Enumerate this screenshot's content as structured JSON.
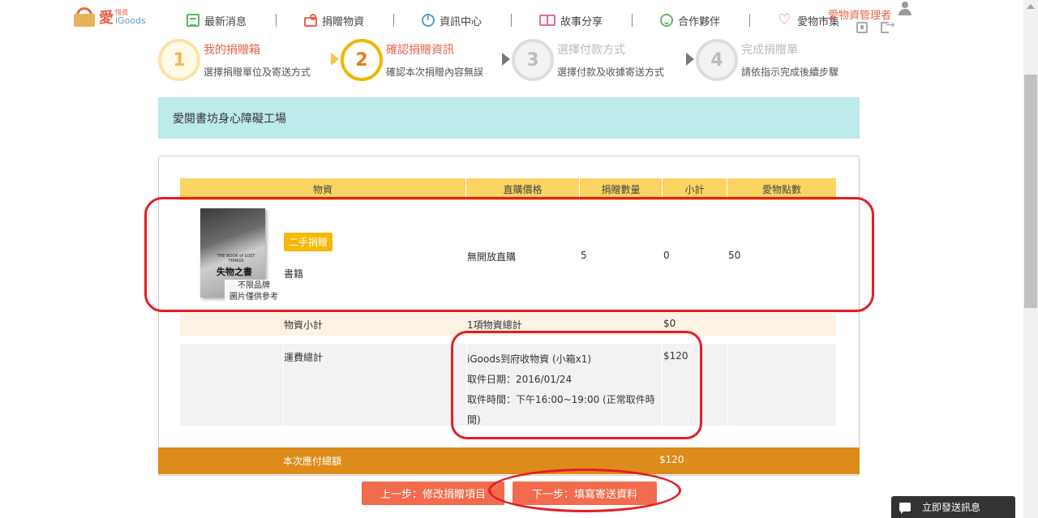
{
  "brand": {
    "name_zh": "愛",
    "name_small": "惜資",
    "name_en": "iGoods"
  },
  "nav": [
    {
      "label": "最新消息"
    },
    {
      "label": "捐贈物資"
    },
    {
      "label": "資訊中心"
    },
    {
      "label": "故事分享"
    },
    {
      "label": "合作夥伴"
    },
    {
      "label": "愛物市集"
    }
  ],
  "user": {
    "name": "愛物資管理者"
  },
  "steps": [
    {
      "num": "1",
      "title": "我的捐贈箱",
      "desc": "選擇捐贈單位及寄送方式",
      "state": "done"
    },
    {
      "num": "2",
      "title": "確認捐贈資訊",
      "desc": "確認本次捐贈內容無誤",
      "state": "active"
    },
    {
      "num": "3",
      "title": "選擇付款方式",
      "desc": "選擇付款及收據寄送方式",
      "state": "pending"
    },
    {
      "num": "4",
      "title": "完成捐贈單",
      "desc": "請依指示完成後續步驟",
      "state": "pending"
    }
  ],
  "organization": "愛閱書坊身心障礙工場",
  "table": {
    "headers": [
      "物資",
      "直購價格",
      "捐贈數量",
      "小計",
      "愛物點數"
    ],
    "item": {
      "book_cover_subtitle": "THE BOOK of LOST THINGS",
      "book_cover_title": "失物之書",
      "image_note_line1": "不限品牌",
      "image_note_line2": "圖片僅供參考",
      "tag": "二手捐贈",
      "category": "書籍",
      "price": "無開放直購",
      "quantity": "5",
      "subtotal": "0",
      "points": "50"
    },
    "items_subtotal": {
      "label": "物資小計",
      "count_text": "1項物資總計",
      "amount": "$0"
    },
    "shipping": {
      "label": "運費總計",
      "method": "iGoods到府收物資 (小箱x1)",
      "date": "取件日期：2016/01/24",
      "time": "取件時間：下午16:00~19:00 (正常取件時間)",
      "amount": "$120"
    }
  },
  "total": {
    "label": "本次應付總額",
    "amount": "$120"
  },
  "buttons": {
    "prev": "上一步：修改捐贈項目",
    "next": "下一步：填寫寄送資料"
  },
  "chat": {
    "label": "立即發送訊息"
  },
  "colors": {
    "accent": "#e8624a",
    "header_yellow": "#fcd462",
    "total_orange": "#dd8b1a",
    "button": "#f26b4c",
    "org_bar": "#bdeaea",
    "annotation": "#e41d25"
  }
}
